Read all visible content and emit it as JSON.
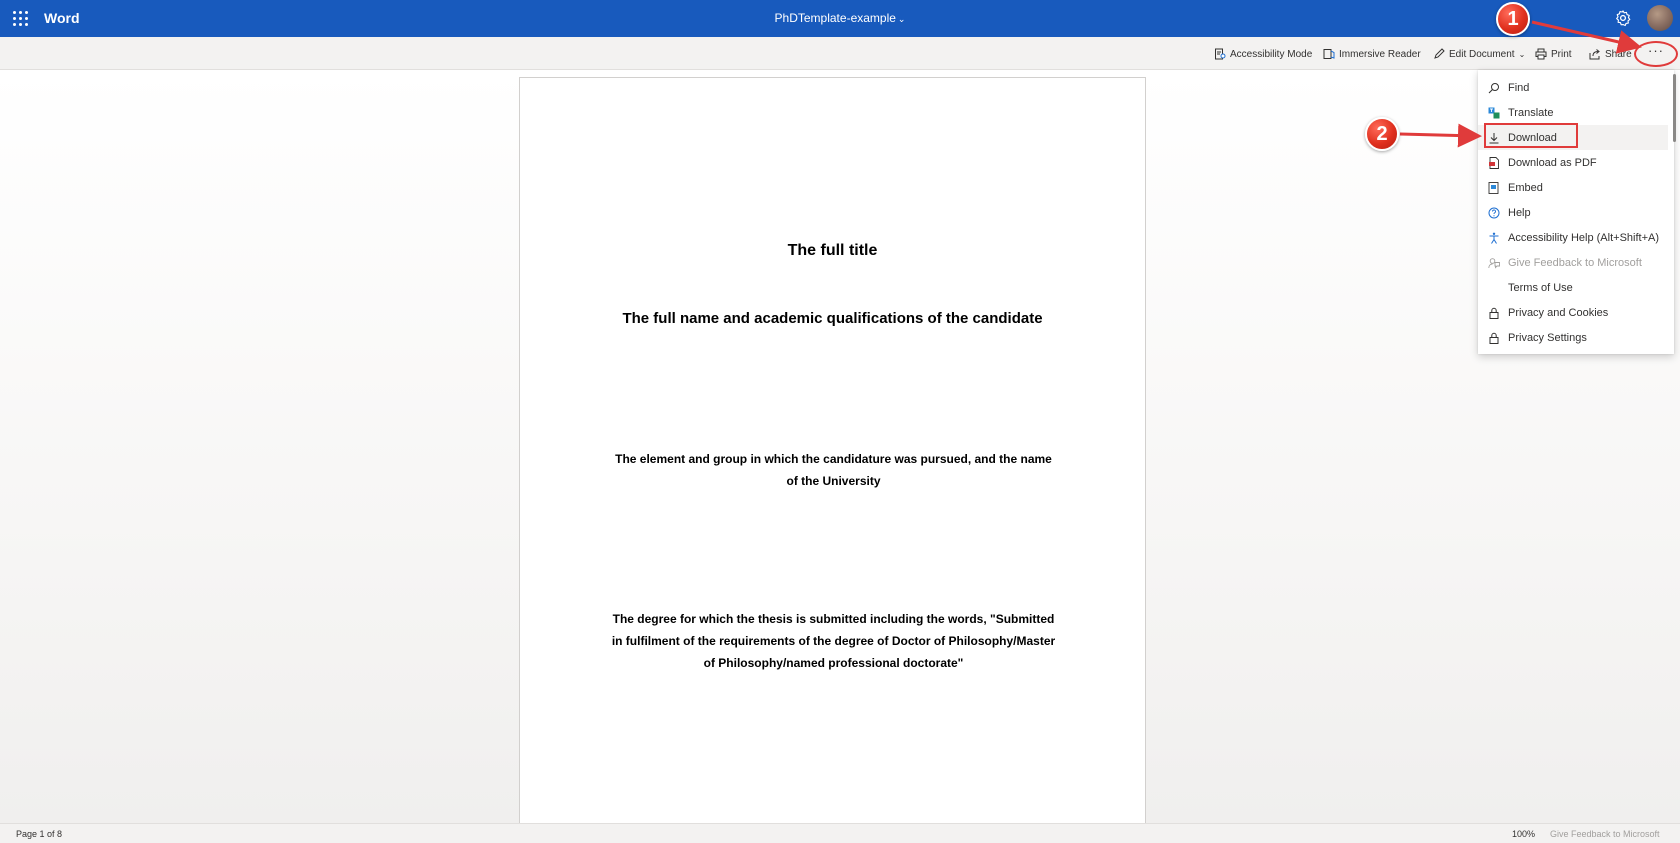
{
  "app": {
    "name": "Word",
    "document_title": "PhDTemplate-example"
  },
  "commandbar": {
    "accessibility_mode": "Accessibility Mode",
    "immersive_reader": "Immersive Reader",
    "edit_document": "Edit Document",
    "print": "Print",
    "share": "Share",
    "more": "···"
  },
  "menu": {
    "items": [
      {
        "label": "Find",
        "icon": "search-icon",
        "enabled": true
      },
      {
        "label": "Translate",
        "icon": "translate-icon",
        "enabled": true
      },
      {
        "label": "Download",
        "icon": "download-icon",
        "enabled": true
      },
      {
        "label": "Download as PDF",
        "icon": "pdf-icon",
        "enabled": true
      },
      {
        "label": "Embed",
        "icon": "embed-icon",
        "enabled": true
      },
      {
        "label": "Help",
        "icon": "help-icon",
        "enabled": true
      },
      {
        "label": "Accessibility Help (Alt+Shift+A)",
        "icon": "accessibility-icon",
        "enabled": true
      },
      {
        "label": "Give Feedback to Microsoft",
        "icon": "feedback-icon",
        "enabled": false
      },
      {
        "label": "Terms of Use",
        "icon": "",
        "enabled": true
      },
      {
        "label": "Privacy and Cookies",
        "icon": "lock-icon",
        "enabled": true
      },
      {
        "label": "Privacy Settings",
        "icon": "lock-icon",
        "enabled": true
      }
    ]
  },
  "document": {
    "title": "The full title",
    "candidate": "The full name and academic qualifications of the candidate",
    "element": "The element and group in which the candidature was pursued, and the name of the University",
    "degree": "The degree for which the thesis is submitted including the words, \"Submitted in fulfilment of the requirements of the degree of Doctor of Philosophy/Master of Philosophy/named professional doctorate\""
  },
  "annotations": {
    "step1": "1",
    "step2": "2"
  },
  "statusbar": {
    "page_info": "Page 1 of 8",
    "zoom": "100%",
    "feedback": "Give Feedback to Microsoft"
  },
  "colors": {
    "brand_blue": "#185abd",
    "annotation_red": "#e03b3b"
  }
}
